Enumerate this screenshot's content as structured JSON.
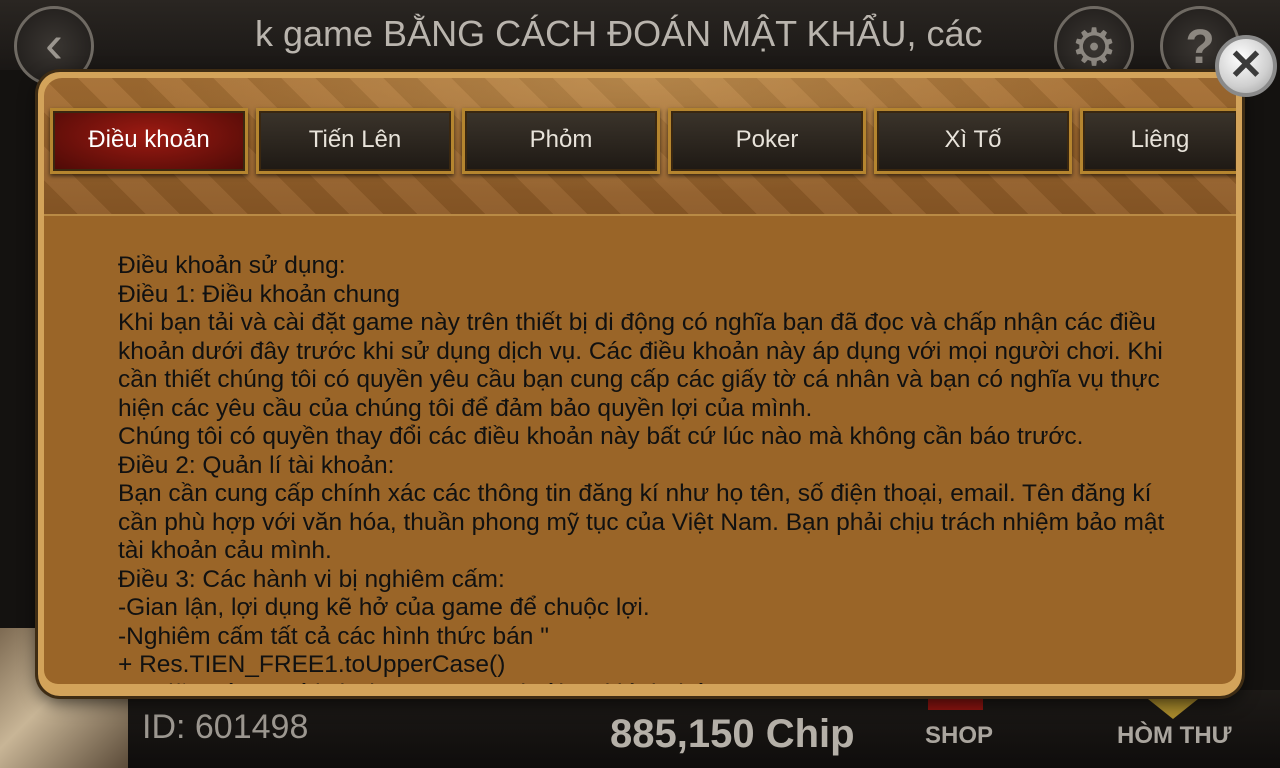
{
  "background": {
    "back_icon": "chevron-left-icon",
    "ticker_text": "k game BẰNG CÁCH ĐOÁN MẬT KHẨU, các",
    "settings_icon": "gear-icon",
    "help_icon": "help-icon",
    "user_id": "ID: 601498",
    "chip_balance": "885,150 Chip",
    "shop_label": "SHOP",
    "mailbox_label": "HÒM THƯ"
  },
  "dialog": {
    "close_glyph": "✕",
    "tabs": [
      {
        "label": "Điều khoản",
        "active": true
      },
      {
        "label": "Tiến Lên",
        "active": false
      },
      {
        "label": "Phỏm",
        "active": false
      },
      {
        "label": "Poker",
        "active": false
      },
      {
        "label": "Xì Tố",
        "active": false
      },
      {
        "label": "Liêng",
        "active": false
      }
    ],
    "content": "Điều khoản sử dụng:\nĐiều 1: Điều khoản chung\nKhi bạn tải và cài đặt game này trên thiết bị di động có nghĩa bạn đã đọc và chấp nhận các điều khoản dưới đây trước khi sử dụng dịch vụ. Các điều khoản này áp dụng với mọi người chơi. Khi cần thiết chúng tôi có quyền yêu cầu bạn cung cấp các giấy tờ cá nhân và bạn có nghĩa vụ thực hiện các yêu cầu của chúng tôi để đảm bảo quyền lợi của mình.\nChúng tôi có quyền thay đổi các điều khoản này bất cứ lúc nào mà không cần báo trước.\nĐiều 2: Quản lí tài khoản:\nBạn cần cung cấp chính xác các thông tin đăng kí như họ tên, số điện thoại, email. Tên đăng kí cần phù hợp với văn hóa, thuần phong mỹ tục của Việt Nam. Bạn phải chịu trách nhiệm bảo mật tài khoản cảu mình.\nĐiều 3: Các hành vi bị nghiêm cấm:\n-Gian lận, lợi dụng kẽ hở của game để chuộc lợi.\n-Nghiêm cấm tất cả các hình thức bán \"\n+ Res.TIEN_FREE1.toUpperCase()\n+ \" giữa các người chơi trong game dưới mọi hình thức"
  }
}
